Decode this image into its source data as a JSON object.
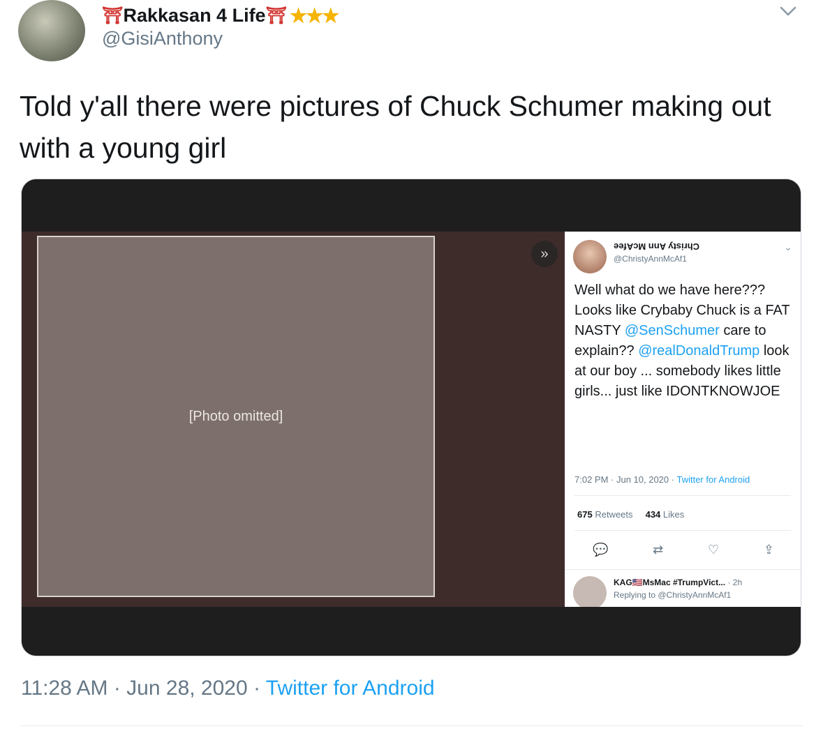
{
  "author": {
    "name": "Rakkasan 4 Life",
    "torii_icon": "torii-gate-icon",
    "stars_icon": "star-icon",
    "handle": "@GisiAnthony"
  },
  "tweet": {
    "text": "Told y'all there were pictures of Chuck Schumer making out with a young girl"
  },
  "media": {
    "photo_placeholder": "[Photo omitted]",
    "embedded": {
      "name": "Christy Ann McAfee",
      "handle": "@ChristyAnnMcAf1",
      "text_1": "Well what do we have here??? Looks like Crybaby Chuck is a FAT NASTY ",
      "mention_1": "@SenSchumer",
      "text_2": " care to explain?? ",
      "mention_2": "@realDonaldTrump",
      "text_3": " look at our boy ... somebody likes little girls... just like IDONTKNOWJOE",
      "meta_time": "7:02 PM · Jun 10, 2020 · ",
      "meta_source": "Twitter for Android",
      "retweets_count": "675",
      "retweets_label": "Retweets",
      "likes_count": "434",
      "likes_label": "Likes",
      "reply_name": "KAG🇺🇸MsMac #TrumpVict...",
      "reply_time": "· 2h",
      "reply_to": "Replying to @ChristyAnnMcAf1"
    }
  },
  "footer": {
    "timestamp": "11:28 AM · Jun 28, 2020 · ",
    "source": "Twitter for Android"
  }
}
